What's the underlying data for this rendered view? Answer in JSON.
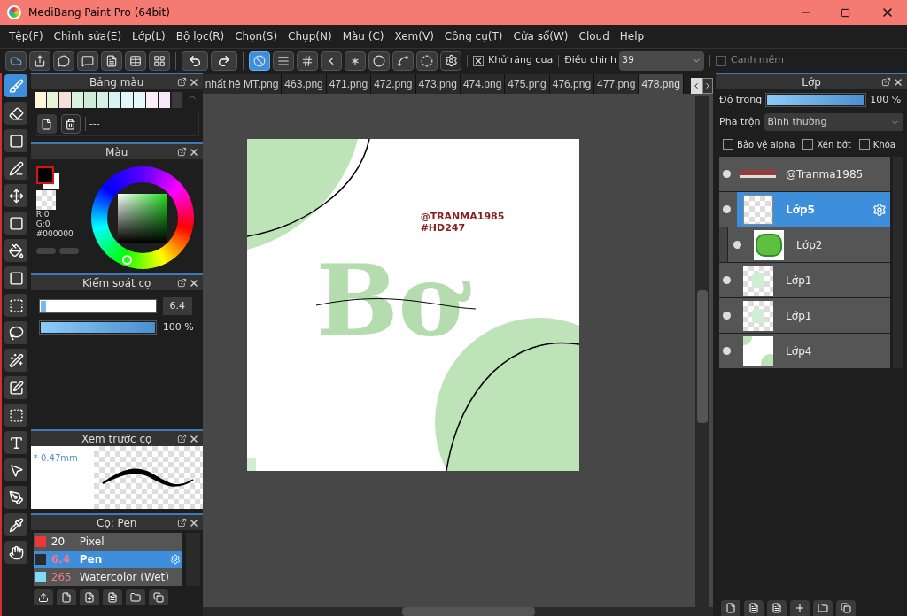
{
  "window": {
    "title": "MediBang Paint Pro (64bit)"
  },
  "menu": [
    "Tệp(F)",
    "Chỉnh sửa(E)",
    "Lớp(L)",
    "Bộ lọc(R)",
    "Chọn(S)",
    "Chụp(N)",
    "Màu (C)",
    "Xem(V)",
    "Công cụ(T)",
    "Cửa sổ(W)",
    "Cloud",
    "Help"
  ],
  "toolbar": {
    "snap_tools": [
      {
        "selected": true
      },
      {
        "selected": false
      },
      {
        "selected": false
      },
      {
        "selected": false
      },
      {
        "selected": false
      },
      {
        "selected": false
      },
      {
        "selected": false
      },
      {
        "selected": false
      }
    ],
    "antialias": {
      "label": "Khử răng cưa",
      "checked": true
    },
    "adjust": {
      "label": "Điều chinh",
      "value": "39"
    },
    "soft_edge": {
      "label": "Cạnh mềm",
      "checked": false
    }
  },
  "tools": [
    {
      "selected": true
    },
    {
      "selected": false
    },
    {
      "selected": false
    },
    {
      "selected": false
    },
    {
      "selected": false
    },
    {
      "selected": false
    },
    {
      "selected": false
    },
    {
      "selected": false
    },
    {
      "selected": false
    },
    {
      "selected": false
    },
    {
      "selected": false
    },
    {
      "selected": false
    },
    {
      "selected": false
    },
    {
      "selected": false
    },
    {
      "selected": false
    },
    {
      "selected": false
    },
    {
      "selected": false
    },
    {
      "selected": false
    }
  ],
  "palette_panel": {
    "title": "Bảng màu",
    "palette_name": "---",
    "swatches": [
      {
        "color": "#fff8d8"
      },
      {
        "color": "#e9f3d6"
      },
      {
        "color": "#f7dedd"
      },
      {
        "color": "#d9f1dd"
      },
      {
        "color": "#cdebd7"
      },
      {
        "color": "#d6f1e4"
      },
      {
        "color": "#d8f3f3"
      },
      {
        "color": "#e0f6fa"
      },
      {
        "color": "#e6f7fc"
      },
      {
        "color": "#fbeefa"
      },
      {
        "color": "#f6e8f8"
      }
    ]
  },
  "color_panel": {
    "title": "Màu",
    "r": "R:0",
    "g": "G:0",
    "hex": "#000000"
  },
  "brush_control": {
    "title": "Kiểm soát cọ",
    "size": {
      "value": "6.4",
      "level": 0.05
    },
    "opacity": {
      "value": "100 %",
      "level": 1
    }
  },
  "brush_preview": {
    "title": "Xem trước cọ",
    "size": "* 0.47mm"
  },
  "brush_list": {
    "title": "Cọ: Pen",
    "items": [
      {
        "color": "#f03535",
        "size": "20",
        "name": "Pixel",
        "selected": false
      },
      {
        "color": "#2a2a2a",
        "size": "6.4",
        "name": "Pen",
        "selected": true
      },
      {
        "color": "#7fdcf8",
        "size": "265",
        "name": "Watercolor (Wet)",
        "selected": false
      }
    ]
  },
  "tabs": [
    {
      "label": "nhất hệ MT.png",
      "selected": false
    },
    {
      "label": "463.png",
      "selected": false
    },
    {
      "label": "471.png",
      "selected": false
    },
    {
      "label": "472.png",
      "selected": false
    },
    {
      "label": "473.png",
      "selected": false
    },
    {
      "label": "474.png",
      "selected": false
    },
    {
      "label": "475.png",
      "selected": false
    },
    {
      "label": "476.png",
      "selected": false
    },
    {
      "label": "477.png",
      "selected": false
    },
    {
      "label": "478.png",
      "selected": true
    }
  ],
  "artwork": {
    "handle": "@TRANMA1985",
    "tag": "#HD247",
    "letters": "Bơ"
  },
  "layers_panel": {
    "title": "Lớp",
    "opacity_label": "Độ trong",
    "opacity": {
      "value": "100 %",
      "level": 1
    },
    "blend_label": "Pha trộn",
    "blend_value": "Bình thường",
    "options": [
      {
        "label": "Bảo vệ alpha",
        "checked": false
      },
      {
        "label": "Xén bớt",
        "checked": false
      },
      {
        "label": "Khóa",
        "checked": false
      }
    ],
    "layers": [
      {
        "name": "@Tranma1985",
        "kind": "text",
        "selected": false,
        "clipped": false
      },
      {
        "name": "Lớp5",
        "kind": "lines",
        "selected": true,
        "clipped": false
      },
      {
        "name": "Lớp2",
        "kind": "green",
        "selected": false,
        "clipped": true
      },
      {
        "name": "Lớp1",
        "kind": "letters",
        "selected": false,
        "clipped": false
      },
      {
        "name": "Lớp1",
        "kind": "letters",
        "selected": false,
        "clipped": false
      },
      {
        "name": "Lớp4",
        "kind": "circles",
        "selected": false,
        "clipped": false
      }
    ]
  }
}
